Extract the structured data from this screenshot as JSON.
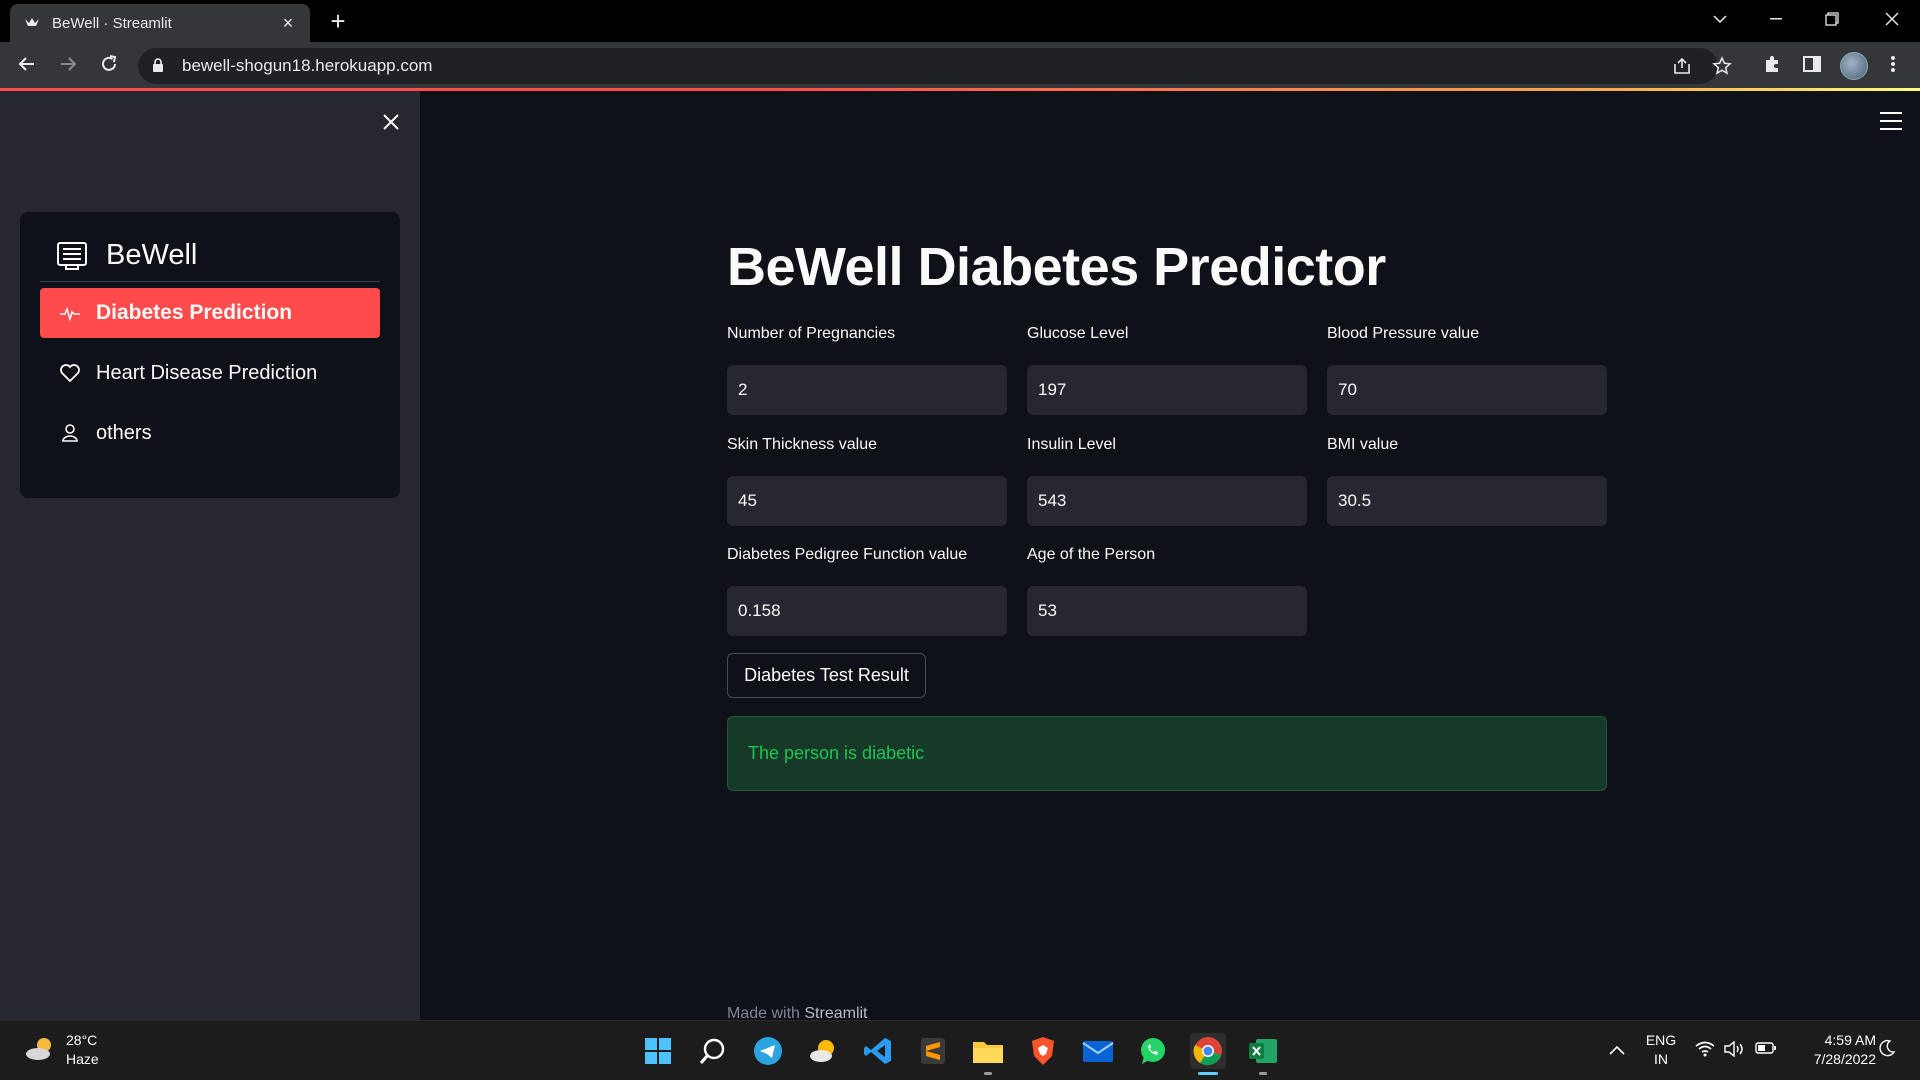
{
  "browser": {
    "tab_title": "BeWell · Streamlit",
    "url": "bewell-shogun18.herokuapp.com",
    "new_tab_label": "+"
  },
  "sidebar": {
    "brand": "BeWell",
    "items": [
      {
        "label": "Diabetes Prediction",
        "icon": "activity-icon",
        "active": true
      },
      {
        "label": "Heart Disease Prediction",
        "icon": "heart-icon",
        "active": false
      },
      {
        "label": "others",
        "icon": "person-icon",
        "active": false
      }
    ]
  },
  "main": {
    "title": "BeWell Diabetes Predictor",
    "fields": [
      {
        "label": "Number of Pregnancies",
        "value": "2"
      },
      {
        "label": "Glucose Level",
        "value": "197"
      },
      {
        "label": "Blood Pressure value",
        "value": "70"
      },
      {
        "label": "Skin Thickness value",
        "value": "45"
      },
      {
        "label": "Insulin Level",
        "value": "543"
      },
      {
        "label": "BMI value",
        "value": "30.5"
      },
      {
        "label": "Diabetes Pedigree Function value",
        "value": "0.158"
      },
      {
        "label": "Age of the Person",
        "value": "53"
      }
    ],
    "button_label": "Diabetes Test Result",
    "result_text": "The person is diabetic",
    "footer_prefix": "Made with",
    "footer_brand": "Streamlit"
  },
  "taskbar": {
    "temperature": "28°C",
    "condition": "Haze",
    "lang": "ENG",
    "region": "IN",
    "time": "4:59 AM",
    "date": "7/28/2022"
  },
  "colors": {
    "accent": "#ff4b4b",
    "success_text": "#21c354",
    "success_bg": "#173928",
    "app_bg": "#0e1117",
    "sidebar_bg": "#262730"
  }
}
